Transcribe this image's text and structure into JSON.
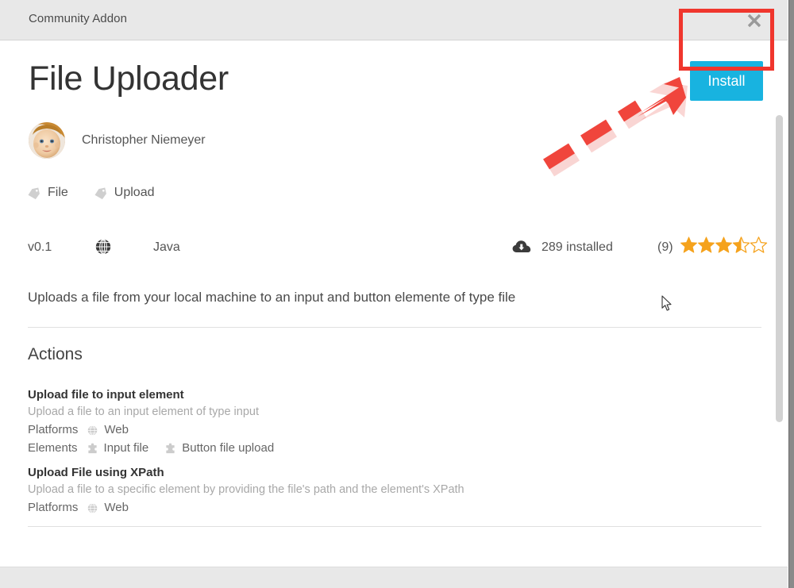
{
  "titlebar": {
    "title": "Community Addon",
    "close_icon": "close-icon"
  },
  "header": {
    "title": "File Uploader",
    "install_label": "Install",
    "install_color": "#18b3e0"
  },
  "annotations": {
    "highlight_color": "#f0362d",
    "arrow_name": "red-dashed-arrow",
    "rect_name": "red-highlight-rectangle"
  },
  "author": {
    "name": "Christopher Niemeyer",
    "avatar_icon": "avatar-photo"
  },
  "tags": [
    {
      "label": "File",
      "icon": "tag-icon"
    },
    {
      "label": "Upload",
      "icon": "tag-icon"
    }
  ],
  "meta": {
    "version": "v0.1",
    "platform_icon": "globe-icon",
    "language": "Java",
    "installs_icon": "cloud-download-icon",
    "installs": "289 installed",
    "rating_count": "(9)",
    "rating_value": 3.5,
    "rating_max": 5,
    "star_color": "#f5a21c"
  },
  "description": "Uploads a file from your local machine to an input and button elemente of type file",
  "actions_heading": "Actions",
  "actions": [
    {
      "title": "Upload file to input element",
      "description": "Upload a file to an input element of type input",
      "attributes": [
        {
          "name": "Platforms",
          "items": [
            {
              "label": "Web",
              "icon": "globe-icon"
            }
          ]
        },
        {
          "name": "Elements",
          "items": [
            {
              "label": "Input file",
              "icon": "puzzle-piece-icon"
            },
            {
              "label": "Button file upload",
              "icon": "puzzle-piece-icon"
            }
          ]
        }
      ]
    },
    {
      "title": "Upload File using XPath",
      "description": "Upload a file to a specific element by providing the file's path and the element's XPath",
      "attributes": [
        {
          "name": "Platforms",
          "items": [
            {
              "label": "Web",
              "icon": "globe-icon"
            }
          ]
        }
      ]
    }
  ],
  "scrollbar": {
    "name": "vertical-scrollbar"
  }
}
